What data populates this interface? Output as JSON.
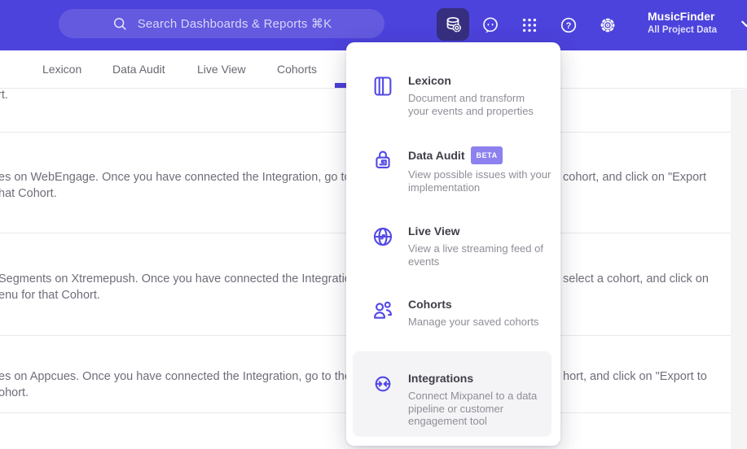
{
  "header": {
    "search": {
      "placeholder": "Search Dashboards & Reports ⌘K"
    },
    "icons": {
      "data_management": "database-gear-icon",
      "feedback": "feedback-smiley-icon",
      "apps": "apps-grid-icon",
      "help": "help-icon",
      "settings": "gear-icon",
      "help_glyph": "?"
    },
    "project": {
      "name": "MusicFinder",
      "scope": "All Project Data"
    },
    "colors": {
      "header_bg": "#4c42dc",
      "active_tile_bg": "#362f80"
    }
  },
  "tabs": {
    "items": [
      {
        "label": "Lexicon"
      },
      {
        "label": "Data Audit"
      },
      {
        "label": "Live View"
      },
      {
        "label": "Cohorts"
      }
    ],
    "indicator_color": "#4b3fd6"
  },
  "menu": {
    "items": [
      {
        "title": "Lexicon",
        "icon": "book-icon",
        "desc": "Document and transform\nyour events and properties"
      },
      {
        "title": "Data Audit",
        "icon": "lock-audit-icon",
        "badge": "BETA",
        "desc": "View possible issues with your\nimplementation"
      },
      {
        "title": "Live View",
        "icon": "globe-icon",
        "desc": "View a live streaming feed of\nevents"
      },
      {
        "title": "Cohorts",
        "icon": "people-icon",
        "desc": "Manage your saved cohorts"
      },
      {
        "title": "Integrations",
        "icon": "sync-arrows-icon",
        "highlighted": true,
        "desc": "Connect Mixpanel to a data\npipeline or customer\nengagement tool"
      }
    ],
    "icon_color": "#5349e6",
    "highlight_bg": "#f4f4f6"
  },
  "content": {
    "row1_l1": "rt.",
    "row2_l1": "es on WebEngage. Once you have connected the Integration, go to the",
    "row2_r1": "cohort, and click on \"Export",
    "row2_l2": "hat Cohort.",
    "row3_l1": "Segments on Xtremepush. Once you have connected the Integration, ",
    "row3_r1": "select a cohort, and click on",
    "row3_l2": "enu for that Cohort.",
    "row4_l1": "es on Appcues. Once you have connected the Integration, go to the M",
    "row4_r1": "hort, and click on \"Export to",
    "row4_l2": "ohort."
  }
}
